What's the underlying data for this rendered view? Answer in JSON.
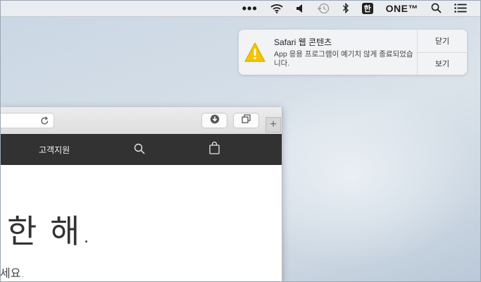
{
  "menubar": {
    "overflow_label": "•••",
    "input_source": "한",
    "user_name": "ONE™",
    "icons": [
      "wifi-icon",
      "volume-icon",
      "time-machine-icon",
      "bluetooth-icon",
      "spotlight-icon",
      "notification-center-icon"
    ]
  },
  "notification": {
    "title": "Safari 웹 콘텐츠",
    "body": "App 응용 프로그램이 예기치 않게 종료되었습니다.",
    "close_label": "닫기",
    "show_label": "보기",
    "icon": "warning-icon"
  },
  "safari": {
    "nav_support": "고객지원",
    "headline": "한 해.",
    "subline": "세요."
  },
  "colors": {
    "nav_bg": "#323232",
    "warning_yellow": "#f5c400"
  }
}
